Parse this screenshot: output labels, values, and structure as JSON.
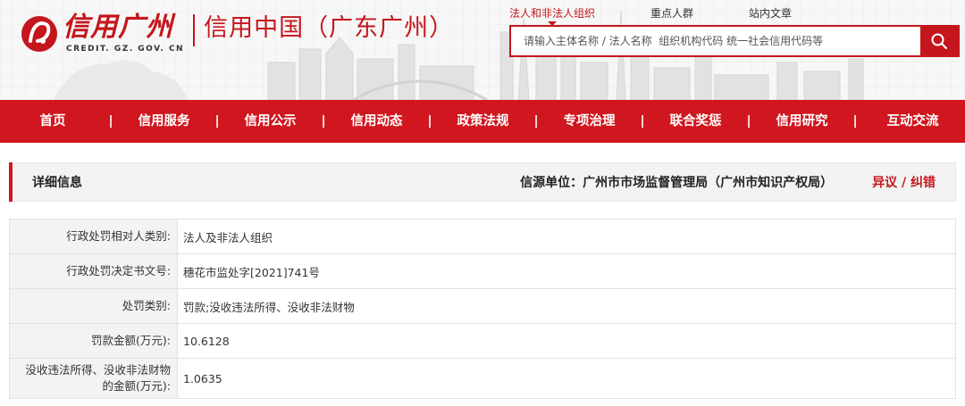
{
  "header": {
    "logo_cn": "信用广州",
    "logo_en": "CREDIT. GZ. GOV. CN",
    "site_sub": "信用中国（广东广州）"
  },
  "search": {
    "tabs": [
      {
        "label": "法人和非法人组织",
        "active": true
      },
      {
        "label": "重点人群",
        "active": false
      },
      {
        "label": "站内文章",
        "active": false
      }
    ],
    "placeholder": "请输入主体名称 / 法人名称  组织机构代码 统一社会信用代码等",
    "button_icon": "search-icon"
  },
  "nav": {
    "items": [
      "首页",
      "信用服务",
      "信用公示",
      "信用动态",
      "政策法规",
      "专项治理",
      "联合奖惩",
      "信用研究",
      "互动交流"
    ]
  },
  "detail": {
    "title": "详细信息",
    "source": "信源单位：广州市市场监督管理局（广州市知识产权局）",
    "objection": "异议 / 纠错"
  },
  "rows": [
    {
      "label": "行政处罚相对人类别:",
      "value": "法人及非法人组织"
    },
    {
      "label": "行政处罚决定书文号:",
      "value": "穗花市监处字[2021]741号"
    },
    {
      "label": "处罚类别:",
      "value": "罚款;没收违法所得、没收非法财物"
    },
    {
      "label": "罚款金额(万元):",
      "value": "10.6128"
    },
    {
      "label_line1": "没收违法所得、没收非法财物",
      "label_line2": "的金额(万元):",
      "value": "1.0635"
    }
  ],
  "colors": {
    "brand_red": "#c4161c",
    "nav_red": "#d0161e"
  }
}
